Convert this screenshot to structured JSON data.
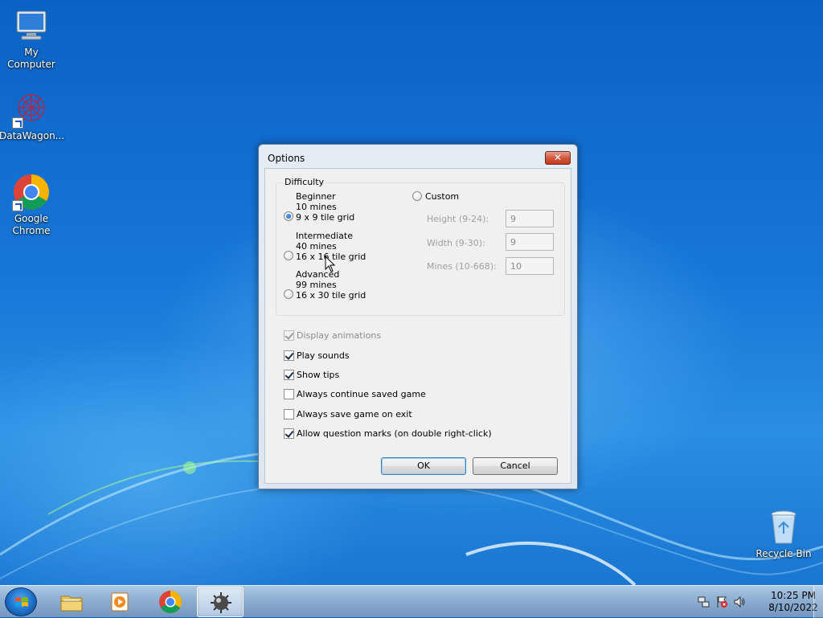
{
  "desktop": {
    "icons": [
      {
        "label": "My Computer",
        "icon": "computer-icon"
      },
      {
        "label": "DataWagon...",
        "icon": "datawagon-icon"
      },
      {
        "label": "Google Chrome",
        "icon": "chrome-icon"
      },
      {
        "label": "Recycle Bin",
        "icon": "recycle-bin-icon"
      }
    ]
  },
  "dialog": {
    "title": "Options",
    "close_glyph": "✕",
    "difficulty": {
      "group_label": "Difficulty",
      "options": [
        {
          "name": "Beginner",
          "mines": "10 mines",
          "grid": "9 x 9 tile grid",
          "selected": true
        },
        {
          "name": "Intermediate",
          "mines": "40 mines",
          "grid": "16 x 16 tile grid",
          "selected": false
        },
        {
          "name": "Advanced",
          "mines": "99 mines",
          "grid": "16 x 30 tile grid",
          "selected": false
        }
      ],
      "custom": {
        "label": "Custom",
        "selected": false,
        "height_label": "Height (9-24):",
        "height_value": "9",
        "width_label": "Width (9-30):",
        "width_value": "9",
        "mines_label": "Mines (10-668):",
        "mines_value": "10"
      }
    },
    "checkboxes": [
      {
        "label": "Display animations",
        "checked": true,
        "enabled": false
      },
      {
        "label": "Play sounds",
        "checked": true,
        "enabled": true
      },
      {
        "label": "Show tips",
        "checked": true,
        "enabled": true
      },
      {
        "label": "Always continue saved game",
        "checked": false,
        "enabled": true
      },
      {
        "label": "Always save game on exit",
        "checked": false,
        "enabled": true
      },
      {
        "label": "Allow question marks (on double right-click)",
        "checked": true,
        "enabled": true
      }
    ],
    "ok_label": "OK",
    "cancel_label": "Cancel"
  },
  "taskbar": {
    "start_icon": "windows-logo-icon",
    "pinned": [
      "file-explorer-icon",
      "media-player-icon",
      "chrome-icon",
      "minesweeper-icon"
    ],
    "active_item": "minesweeper-icon",
    "tray_icons": [
      "network-icon",
      "action-center-flag-icon",
      "volume-icon"
    ],
    "time": "10:25 PM",
    "date": "8/10/2022"
  }
}
